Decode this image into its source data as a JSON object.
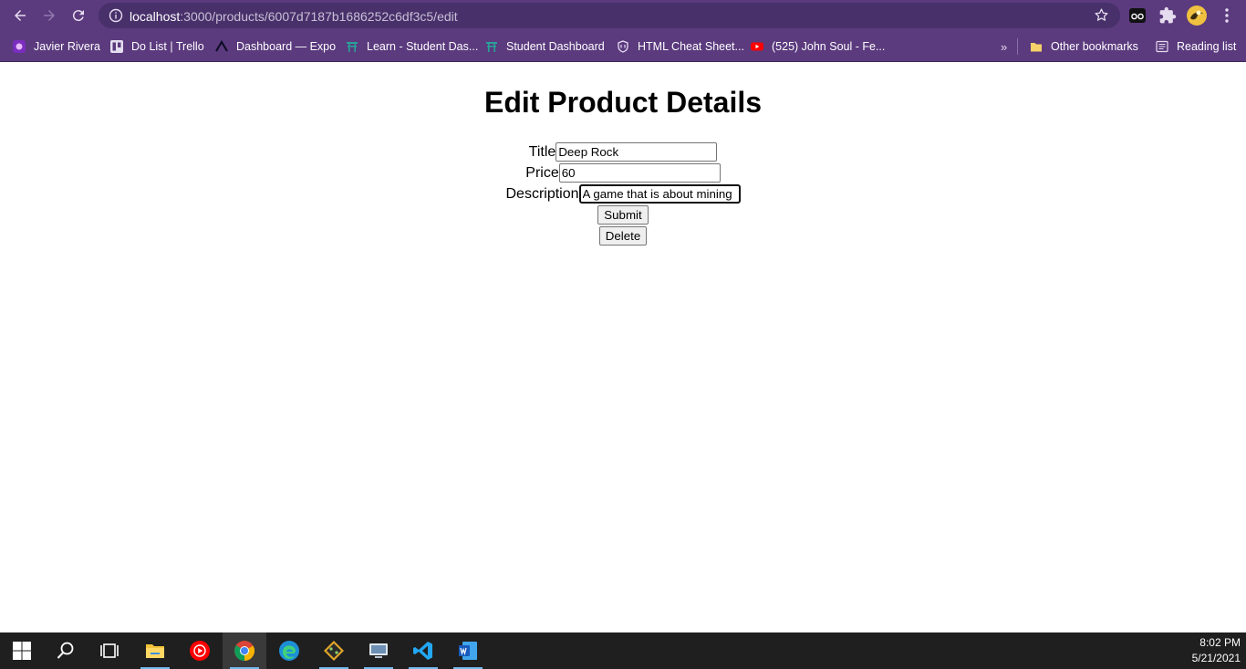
{
  "browser": {
    "url_host": "localhost",
    "url_rest": ":3000/products/6007d7187b1686252c6df3c5/edit"
  },
  "bookmarks": [
    {
      "label": "Javier Rivera",
      "icon": "purple-avatar-icon"
    },
    {
      "label": "Do List | Trello",
      "icon": "trello-icon"
    },
    {
      "label": "Dashboard — Expo",
      "icon": "expo-icon"
    },
    {
      "label": "Learn - Student Das...",
      "icon": "torii-icon"
    },
    {
      "label": "Student Dashboard",
      "icon": "torii-icon"
    },
    {
      "label": "HTML Cheat Sheet...",
      "icon": "shield-icon"
    },
    {
      "label": "(525) John Soul - Fe...",
      "icon": "youtube-icon"
    }
  ],
  "other_bookmarks": "Other bookmarks",
  "reading_list": "Reading list",
  "page": {
    "heading": "Edit Product Details",
    "title_label": "Title",
    "title_value": "Deep Rock",
    "price_label": "Price",
    "price_value": "60",
    "description_label": "Description",
    "description_value": "A game that is about mining",
    "submit_label": "Submit",
    "delete_label": "Delete"
  },
  "taskbar": {
    "time": "8:02 PM",
    "date": "5/21/2021"
  },
  "colors": {
    "chrome": "#5b3a7e",
    "omnibox": "#48306a",
    "taskbar": "#1f1f1f"
  }
}
